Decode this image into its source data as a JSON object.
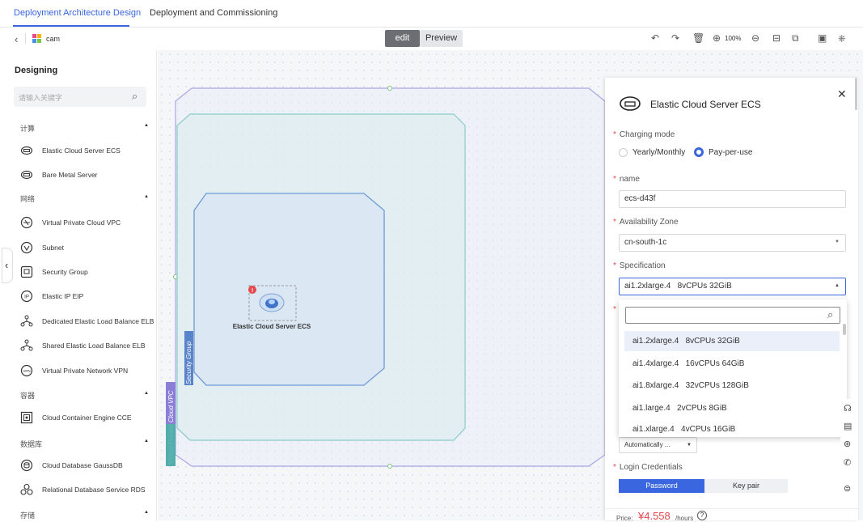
{
  "tabs": [
    {
      "label": "Deployment Architecture Design",
      "active": true
    },
    {
      "label": "Deployment and Commissioning",
      "active": false
    }
  ],
  "toolbar": {
    "back_icon": "chevron-left-icon",
    "project_name": "cam",
    "mode_edit": "edit",
    "mode_preview": "Preview",
    "zoom": "100%"
  },
  "sidebar": {
    "heading": "Designing",
    "search_placeholder": "请输入关键字",
    "categories": [
      {
        "label": "计算",
        "items": [
          "Elastic Cloud Server ECS",
          "Bare Metal Server"
        ]
      },
      {
        "label": "网络",
        "items": [
          "Virtual Private Cloud VPC",
          "Subnet",
          "Security Group",
          "Elastic IP EIP",
          "Dedicated Elastic Load Balance ELB",
          "Shared Elastic Load Balance ELB",
          "Virtual Private Network VPN"
        ]
      },
      {
        "label": "容器",
        "items": [
          "Cloud Container Engine CCE"
        ]
      },
      {
        "label": "数据库",
        "items": [
          "Cloud Database GaussDB",
          "Relational Database Service RDS"
        ]
      },
      {
        "label": "存储",
        "items": []
      }
    ]
  },
  "canvas": {
    "vpc_label": "Virtual Private Cloud VPC",
    "subnet_label": "Subnet",
    "sg_label": "Security Group",
    "node_label": "Elastic Cloud Server ECS",
    "node_badge": "!"
  },
  "panel": {
    "title": "Elastic Cloud Server ECS",
    "charging_label": "Charging mode",
    "charging_options": [
      "Yearly/Monthly",
      "Pay-per-use"
    ],
    "charging_selected": "Pay-per-use",
    "name_label": "name",
    "name_value": "ecs-d43f",
    "az_label": "Availability Zone",
    "az_value": "cn-south-1c",
    "spec_label": "Specification",
    "spec_value": "ai1.2xlarge.4   8vCPUs 32GiB",
    "spec_options": [
      "ai1.2xlarge.4   8vCPUs 32GiB",
      "ai1.4xlarge.4   16vCPUs 64GiB",
      "ai1.8xlarge.4   32vCPUs 128GiB",
      "ai1.large.4   2vCPUs 8GiB",
      "ai1.xlarge.4   4vCPUs 16GiB"
    ],
    "auto_select": "Automatically ...",
    "login_label": "Login Credentials",
    "login_tabs": [
      "Password",
      "Key pair"
    ],
    "price_label": "Price:",
    "price_value": "¥4.558",
    "price_unit": "/hours"
  },
  "colors": {
    "accent": "#3a66e0",
    "danger": "#e5484d"
  }
}
